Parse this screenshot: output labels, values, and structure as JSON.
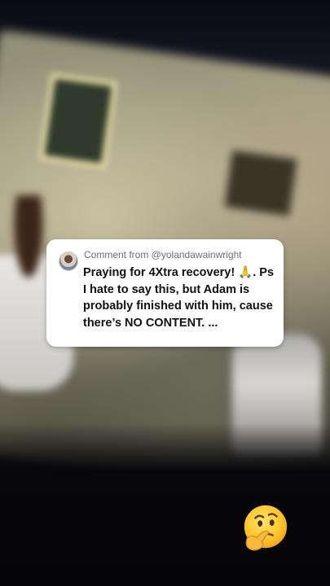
{
  "comment": {
    "header": "Comment from @yolandawainwright",
    "text": "Praying for 4Xtra recovery! 🙏. Ps I hate to say this, but Adam is probably finished with him, cause there’s NO CONTENT. ..."
  },
  "icons": {
    "avatar": "commenter-avatar",
    "reaction": "thinking-face-emoji"
  },
  "colors": {
    "card_bg": "#ffffff",
    "header_text": "#6e6e73",
    "body_text": "#111111"
  }
}
